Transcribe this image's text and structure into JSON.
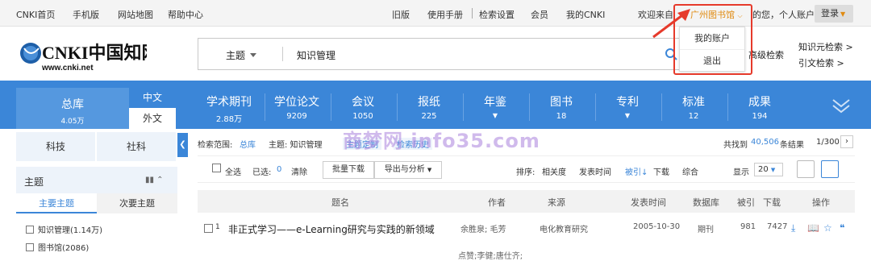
{
  "topbar": {
    "links_left": [
      "CNKI首页",
      "手机版",
      "网站地图",
      "帮助中心"
    ],
    "links_right": [
      "旧版",
      "使用手册",
      "检索设置",
      "会员",
      "我的CNKI"
    ],
    "welcome_prefix": "欢迎来自",
    "org_name": "广州图书馆",
    "welcome_suffix": "的您，个人账户",
    "login_label": "登录"
  },
  "dropdown": {
    "items": [
      "我的账户",
      "退出"
    ]
  },
  "header": {
    "logo_text": "CNKI中国知网",
    "logo_url": "www.cnki.net",
    "search_field": "主题",
    "search_query": "知识管理",
    "advanced_label": "高级检索",
    "right_links": [
      "知识元检索 >",
      "引文检索 >"
    ]
  },
  "nav": {
    "total_label": "总库",
    "total_count": "4.05万",
    "lang_cn": "中文",
    "lang_foreign": "外文",
    "categories": [
      {
        "label": "学术期刊",
        "count": "2.88万"
      },
      {
        "label": "学位论文",
        "count": "9209"
      },
      {
        "label": "会议",
        "count": "1050"
      },
      {
        "label": "报纸",
        "count": "225"
      },
      {
        "label": "年鉴",
        "count": ""
      },
      {
        "label": "图书",
        "count": "18"
      },
      {
        "label": "专利",
        "count": ""
      },
      {
        "label": "标准",
        "count": "12"
      },
      {
        "label": "成果",
        "count": "194"
      }
    ]
  },
  "sidebar": {
    "tabs": [
      "科技",
      "社科"
    ],
    "facet_title": "主题",
    "subtabs": [
      "主要主题",
      "次要主题"
    ],
    "items": [
      "知识管理(1.14万)",
      "图书馆(2086)"
    ]
  },
  "results": {
    "range_label": "检索范围:",
    "range_db": "总库",
    "range_topic": "主题: 知识管理",
    "topic_subscribe": "主题定制",
    "search_history": "检索历史",
    "total_prefix": "共找到",
    "total_count": "40,506",
    "total_suffix": "条结果",
    "page_info": "1/300",
    "toolbar": {
      "select_all": "全选",
      "selected_label": "已选:",
      "selected_count": "0",
      "clear": "清除",
      "batch_download": "批量下载",
      "export": "导出与分析",
      "sort_label": "排序:",
      "sort_options": [
        "相关度",
        "发表时间",
        "被引",
        "下载",
        "综合"
      ],
      "display_label": "显示",
      "page_size": "20"
    },
    "columns": [
      "题名",
      "作者",
      "来源",
      "发表时间",
      "数据库",
      "被引",
      "下载",
      "操作"
    ],
    "rows": [
      {
        "index": "1",
        "title": "非正式学习——e-Learning研究与实践的新领域",
        "authors": "余胜泉; 毛芳",
        "source": "电化教育研究",
        "date": "2005-10-30",
        "database": "期刊",
        "cited": "981",
        "downloads": "7427"
      }
    ],
    "next_partial": "点赞;李健;唐仕齐;"
  },
  "watermark": "商梦网 info35.com",
  "colors": {
    "nav_blue": "#3b86d8",
    "accent_orange": "#e08b12",
    "highlight_red": "#e63a2b"
  }
}
